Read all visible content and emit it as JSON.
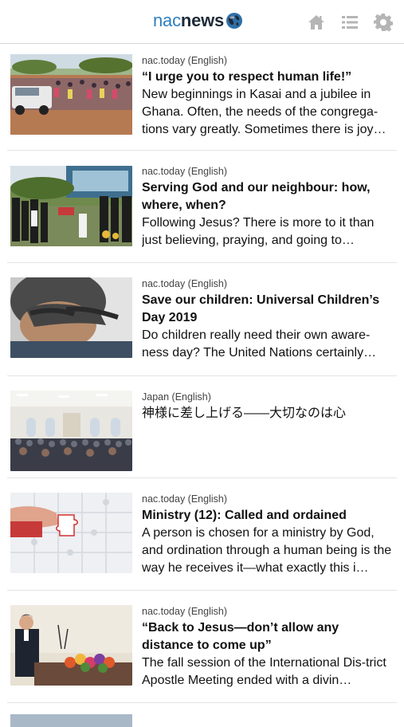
{
  "header": {
    "logo_nac": "nac",
    "logo_news": "news",
    "icons": [
      "home-icon",
      "list-icon",
      "gear-icon"
    ]
  },
  "colors": {
    "brand_blue": "#2f7fbf",
    "brand_dark": "#1f2a38",
    "icon_gray": "#b5b5b5"
  },
  "articles": [
    {
      "source": "nac.today (English)",
      "title": "“I urge you to respect human life!”",
      "teaser": "New beginnings in Kasai and a jubilee in Ghana. Often, the needs of the congrega-tions vary greatly. Sometimes there is joy…"
    },
    {
      "source": "nac.today (English)",
      "title": "Serving God and our neighbour: how, where, when?",
      "teaser": "Following Jesus? There is more to it than just believing, praying, and going to…"
    },
    {
      "source": "nac.today (English)",
      "title": "Save our children: Universal Children’s Day 2019",
      "teaser": "Do children really need their own aware-ness day? The United Nations certainly…"
    },
    {
      "source": "Japan (English)",
      "title": "神様に差し上げる——大切なのは心",
      "teaser": ""
    },
    {
      "source": "nac.today (English)",
      "title": "Ministry (12): Called and ordained",
      "teaser": "A person is chosen for a ministry by God, and ordination through a human being is the way he receives it—what exactly this i…"
    },
    {
      "source": "nac.today (English)",
      "title": "“Back to Jesus—don’t allow any distance to come up”",
      "teaser": "The fall session of the International Dis-trict Apostle Meeting ended with a divin…"
    }
  ]
}
